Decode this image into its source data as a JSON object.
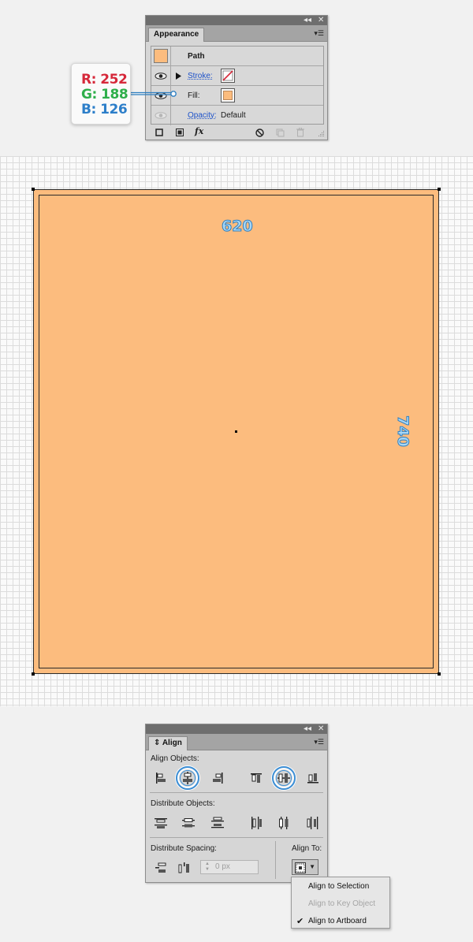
{
  "appearance_panel": {
    "tab_label": "Appearance",
    "titlebar_collapse": "◂◂",
    "titlebar_close": "✕",
    "menu": "▾☰",
    "object_label": "Path",
    "stroke_label": "Stroke:",
    "fill_label": "Fill:",
    "opacity_label": "Opacity:",
    "opacity_value": "Default",
    "fill_color": "#fcbc7e",
    "fx_label": "fx",
    "icons": [
      "eye-icon",
      "expand-triangle-icon",
      "new-stroke-icon",
      "new-fill-icon",
      "fx-icon",
      "clear-appearance-icon",
      "duplicate-item-icon",
      "trash-icon"
    ]
  },
  "color_callout": {
    "r_text": "R: 252",
    "g_text": "G: 188",
    "b_text": "B: 126",
    "r_color": "#d6283a",
    "g_color": "#2eae4a",
    "b_color": "#2c7ec9"
  },
  "artboard": {
    "shape_fill": "#fcbc7e",
    "width_label": "620",
    "height_label": "740"
  },
  "align_panel": {
    "tab_label": "Align",
    "tab_prefix": "⇕",
    "titlebar_collapse": "◂◂",
    "titlebar_close": "✕",
    "menu": "▾☰",
    "align_objects_label": "Align Objects:",
    "distribute_objects_label": "Distribute Objects:",
    "distribute_spacing_label": "Distribute Spacing:",
    "align_to_label": "Align To:",
    "spacing_value": "0 px",
    "highlighted_buttons": [
      "horizontal-align-center-button",
      "vertical-align-center-button"
    ]
  },
  "align_dropdown": {
    "items": [
      {
        "label": "Align to Selection",
        "enabled": true,
        "checked": false
      },
      {
        "label": "Align to Key Object",
        "enabled": false,
        "checked": false
      },
      {
        "label": "Align to Artboard",
        "enabled": true,
        "checked": true
      }
    ],
    "check_mark": "✔"
  }
}
